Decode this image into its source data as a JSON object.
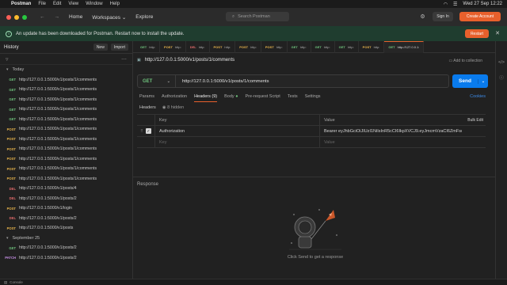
{
  "colors": {
    "get": "#6ec27c",
    "post": "#e8b44b",
    "del": "#e26a6a",
    "patch": "#c48ee3",
    "accent": "#e8602c",
    "send": "#097bed"
  },
  "menubar": {
    "app": "Postman",
    "items": [
      "File",
      "Edit",
      "View",
      "Window",
      "Help"
    ],
    "datetime": "Wed 27 Sep  12:22"
  },
  "titlebar": {
    "home": "Home",
    "workspaces": "Workspaces",
    "explore": "Explore",
    "search_placeholder": "Search Postman",
    "sign_in": "Sign In",
    "create_account": "Create Account"
  },
  "banner": {
    "text": "An update has been downloaded for Postman. Restart now to install the update.",
    "restart": "Restart"
  },
  "sidebar": {
    "title": "History",
    "new_label": "New",
    "import_label": "Import",
    "groups": [
      {
        "label": "Today",
        "items": [
          {
            "method": "GET",
            "url": "http://127.0.0.1:5000/v1/posts/1/comments"
          },
          {
            "method": "GET",
            "url": "http://127.0.0.1:5000/v1/posts/1/comments"
          },
          {
            "method": "GET",
            "url": "http://127.0.0.1:5000/v1/posts/1/comments"
          },
          {
            "method": "GET",
            "url": "http://127.0.0.1:5000/v1/posts/1/comments"
          },
          {
            "method": "GET",
            "url": "http://127.0.0.1:5000/v1/posts/1/comments"
          },
          {
            "method": "POST",
            "url": "http://127.0.0.1:5000/v1/posts/1/comments"
          },
          {
            "method": "POST",
            "url": "http://127.0.0.1:5000/v1/posts/1/comments"
          },
          {
            "method": "POST",
            "url": "http://127.0.0.1:5000/v1/posts/1/comments"
          },
          {
            "method": "POST",
            "url": "http://127.0.0.1:5000/v1/posts/1/comments"
          },
          {
            "method": "POST",
            "url": "http://127.0.0.1:5000/v1/posts/1/comments"
          },
          {
            "method": "POST",
            "url": "http://127.0.0.1:5000/v1/posts/1/comments"
          },
          {
            "method": "DEL",
            "url": "http://127.0.0.1:5000/v1/posts/4"
          },
          {
            "method": "DEL",
            "url": "http://127.0.0.1:5000/v1/posts/2"
          },
          {
            "method": "POST",
            "url": "http://127.0.0.1:5000/v1/login"
          },
          {
            "method": "DEL",
            "url": "http://127.0.0.1:5000/v1/posts/2"
          },
          {
            "method": "POST",
            "url": "http://127.0.0.1:5000/v1/posts"
          }
        ]
      },
      {
        "label": "September 25",
        "items": [
          {
            "method": "GET",
            "url": "http://127.0.0.1:5000/v1/posts/2"
          },
          {
            "method": "PATCH",
            "url": "http://127.0.0.1:5000/v1/posts/2"
          }
        ]
      }
    ]
  },
  "tabs": [
    {
      "method": "GET",
      "label": "http:"
    },
    {
      "method": "POST",
      "label": "http:"
    },
    {
      "method": "DEL",
      "label": "http:"
    },
    {
      "method": "POST",
      "label": "http:"
    },
    {
      "method": "POST",
      "label": "http:"
    },
    {
      "method": "POST",
      "label": "http:"
    },
    {
      "method": "GET",
      "label": "http:"
    },
    {
      "method": "GET",
      "label": "http:"
    },
    {
      "method": "GET",
      "label": "http:"
    },
    {
      "method": "POST",
      "label": "http:"
    },
    {
      "method": "GET",
      "label": "http://127.0.0.1:"
    }
  ],
  "request": {
    "title": "http://127.0.0.1:5000/v1/posts/1/comments",
    "add_to_collection": "Add to collection",
    "method": "GET",
    "url": "http://127.0.0.1:5000/v1/posts/1/comments",
    "send": "Send",
    "tabs": [
      "Params",
      "Authorization",
      "Headers (9)",
      "Body",
      "Pre-request Script",
      "Tests",
      "Settings"
    ],
    "cookies": "Cookies",
    "headers_label": "Headers",
    "hidden_label": "8 hidden",
    "cols": {
      "key": "Key",
      "value": "Value",
      "bulk": "Bulk Edit"
    },
    "rows": [
      {
        "key": "Authorization",
        "value": "Bearer eyJhbGciOiJIUzI1NiIsInR5cCI6IkpXVCJ9.eyJmcmVzaCI6ZmFsc2UsImlh..."
      }
    ],
    "empty_key": "Key",
    "empty_value": "Value"
  },
  "response": {
    "label": "Response",
    "hint": "Click Send to get a response"
  },
  "status": {
    "console": "Console"
  }
}
